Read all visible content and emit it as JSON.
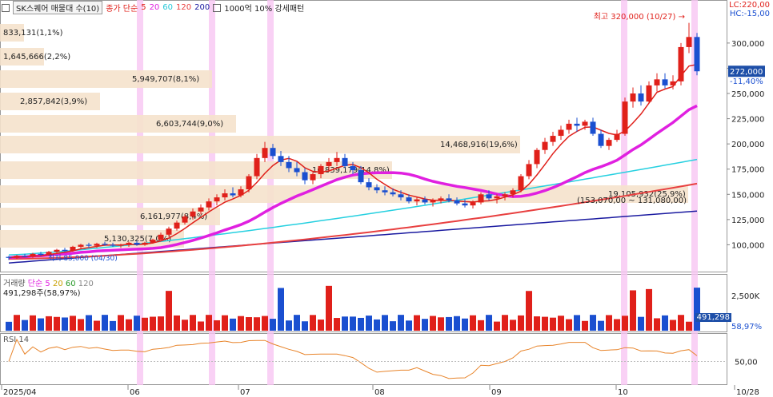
{
  "header": {
    "title": "SK스퀘어 매물대 수(10)",
    "ma_label": "종가 단순",
    "ma_periods": [
      "5",
      "20",
      "60",
      "120",
      "200"
    ],
    "ma_colors": [
      "#e0201a",
      "#e020e0",
      "#26d0e0",
      "#e84040",
      "#1a1aa0"
    ],
    "extra": "1000억 10% 강세패턴"
  },
  "limits": {
    "lc": "LC:220,00",
    "hc": "HC:-15,00"
  },
  "annotations": {
    "peak": "최고 320,000 (10/27) →",
    "low": "최저 85,000 (04/30)",
    "current_price": "272,000",
    "current_change": "-11,40%",
    "range_text": "(153,070,00 ~ 131,080,00)"
  },
  "volume_profile": [
    {
      "label": "833,131(1,1%)"
    },
    {
      "label": "1,645,666(2,2%)"
    },
    {
      "label": "5,949,707(8,1%)"
    },
    {
      "label": "2,857,842(3,9%)"
    },
    {
      "label": "6,603,744(9,0%)"
    },
    {
      "label": "14,468,916(19,6%)"
    },
    {
      "label": "10,839,179(14,8%)"
    },
    {
      "label": "19,105,932(25,9%)"
    },
    {
      "label": "6,161,977(8,4%)"
    },
    {
      "label": "5,130,325(7,0%)"
    }
  ],
  "volume_panel": {
    "title": "거래량",
    "ma_label": "단순",
    "ma_periods": [
      "5",
      "20",
      "60",
      "120"
    ],
    "current": "491,298주(58,97%)",
    "tag_value": "491,298",
    "tag_pct": "58,97%"
  },
  "rsi_panel": {
    "title": "RSI 14"
  },
  "chart_data": {
    "type": "candlestick",
    "x_labels": [
      "2025/04",
      "06",
      "07",
      "08",
      "09",
      "10",
      "10/28"
    ],
    "price_axis": {
      "ticks": [
        "300,000",
        "275,000",
        "250,000",
        "225,000",
        "200,000",
        "175,000",
        "150,000",
        "125,000",
        "100,000"
      ],
      "ylim": [
        75000,
        330000
      ]
    },
    "volume_axis": {
      "ticks": [
        "2,500K"
      ]
    },
    "rsi_axis": {
      "ticks": [
        "50,00"
      ]
    },
    "series": [
      {
        "name": "candles",
        "points": [
          [
            88000,
            89000,
            85000,
            87000
          ],
          [
            87000,
            90000,
            86000,
            89000
          ],
          [
            89000,
            91000,
            88000,
            88000
          ],
          [
            88000,
            92000,
            87000,
            91000
          ],
          [
            91000,
            93000,
            89000,
            90000
          ],
          [
            90000,
            94000,
            89000,
            93000
          ],
          [
            93000,
            96000,
            92000,
            95000
          ],
          [
            95000,
            97000,
            93000,
            94000
          ],
          [
            94000,
            99000,
            93000,
            98000
          ],
          [
            98000,
            101000,
            96000,
            100000
          ],
          [
            100000,
            102000,
            97000,
            99000
          ],
          [
            99000,
            102000,
            97000,
            101000
          ],
          [
            101000,
            103000,
            99000,
            100000
          ],
          [
            100000,
            102000,
            98000,
            99000
          ],
          [
            99000,
            101000,
            97000,
            100000
          ],
          [
            100000,
            103000,
            98000,
            102000
          ],
          [
            102000,
            104000,
            99000,
            100000
          ],
          [
            100000,
            103000,
            99000,
            102000
          ],
          [
            102000,
            106000,
            101000,
            105000
          ],
          [
            105000,
            112000,
            104000,
            110000
          ],
          [
            110000,
            118000,
            108000,
            116000
          ],
          [
            116000,
            124000,
            114000,
            122000
          ],
          [
            122000,
            130000,
            120000,
            128000
          ],
          [
            128000,
            136000,
            125000,
            133000
          ],
          [
            133000,
            140000,
            130000,
            137000
          ],
          [
            137000,
            146000,
            134000,
            143000
          ],
          [
            143000,
            150000,
            139000,
            147000
          ],
          [
            147000,
            155000,
            144000,
            151000
          ],
          [
            151000,
            157000,
            147000,
            149000
          ],
          [
            149000,
            158000,
            147000,
            155000
          ],
          [
            155000,
            170000,
            152000,
            168000
          ],
          [
            168000,
            190000,
            165000,
            186000
          ],
          [
            186000,
            202000,
            182000,
            196000
          ],
          [
            196000,
            200000,
            185000,
            188000
          ],
          [
            188000,
            193000,
            178000,
            182000
          ],
          [
            182000,
            188000,
            172000,
            176000
          ],
          [
            176000,
            182000,
            168000,
            172000
          ],
          [
            172000,
            176000,
            160000,
            164000
          ],
          [
            164000,
            172000,
            160000,
            170000
          ],
          [
            170000,
            180000,
            166000,
            178000
          ],
          [
            178000,
            186000,
            174000,
            182000
          ],
          [
            182000,
            192000,
            178000,
            186000
          ],
          [
            186000,
            190000,
            176000,
            178000
          ],
          [
            178000,
            182000,
            170000,
            174000
          ],
          [
            174000,
            178000,
            160000,
            162000
          ],
          [
            162000,
            166000,
            154000,
            157000
          ],
          [
            157000,
            160000,
            151000,
            154000
          ],
          [
            154000,
            158000,
            149000,
            152000
          ],
          [
            152000,
            156000,
            148000,
            150000
          ],
          [
            150000,
            154000,
            144000,
            147000
          ],
          [
            147000,
            150000,
            141000,
            143000
          ],
          [
            143000,
            147000,
            139000,
            145000
          ],
          [
            145000,
            148000,
            140000,
            142000
          ],
          [
            142000,
            146000,
            138000,
            144000
          ],
          [
            144000,
            148000,
            141000,
            146000
          ],
          [
            146000,
            150000,
            142000,
            144000
          ],
          [
            144000,
            147000,
            139000,
            141000
          ],
          [
            141000,
            145000,
            137000,
            139000
          ],
          [
            139000,
            144000,
            136000,
            142000
          ],
          [
            142000,
            152000,
            140000,
            150000
          ],
          [
            150000,
            154000,
            144000,
            146000
          ],
          [
            146000,
            150000,
            141000,
            148000
          ],
          [
            148000,
            152000,
            144000,
            150000
          ],
          [
            150000,
            156000,
            147000,
            154000
          ],
          [
            154000,
            170000,
            152000,
            168000
          ],
          [
            168000,
            184000,
            165000,
            180000
          ],
          [
            180000,
            196000,
            176000,
            194000
          ],
          [
            194000,
            206000,
            190000,
            202000
          ],
          [
            202000,
            212000,
            198000,
            208000
          ],
          [
            208000,
            218000,
            204000,
            214000
          ],
          [
            214000,
            224000,
            210000,
            220000
          ],
          [
            220000,
            226000,
            212000,
            218000
          ],
          [
            218000,
            224000,
            214000,
            222000
          ],
          [
            222000,
            226000,
            208000,
            210000
          ],
          [
            210000,
            214000,
            196000,
            198000
          ],
          [
            198000,
            206000,
            194000,
            204000
          ],
          [
            204000,
            214000,
            202000,
            210000
          ],
          [
            210000,
            246000,
            208000,
            242000
          ],
          [
            242000,
            256000,
            236000,
            250000
          ],
          [
            250000,
            258000,
            238000,
            242000
          ],
          [
            242000,
            262000,
            240000,
            258000
          ],
          [
            258000,
            270000,
            252000,
            264000
          ],
          [
            264000,
            270000,
            255000,
            258000
          ],
          [
            258000,
            268000,
            254000,
            262000
          ],
          [
            262000,
            300000,
            258000,
            296000
          ],
          [
            296000,
            320000,
            290000,
            306000
          ],
          [
            306000,
            310000,
            268000,
            272000
          ]
        ]
      }
    ]
  }
}
